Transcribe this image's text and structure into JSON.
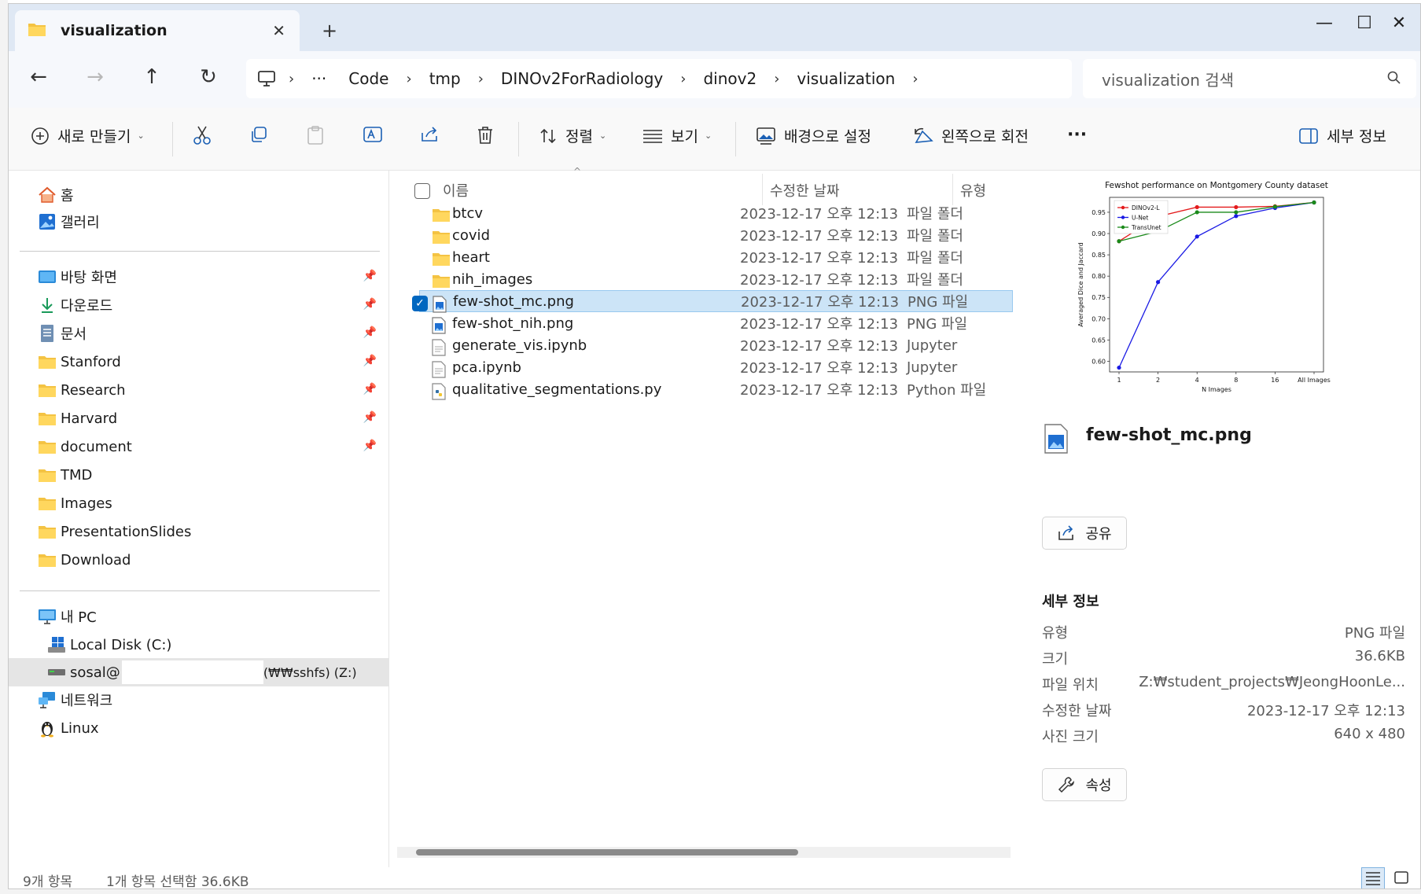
{
  "tab": {
    "title": "visualization",
    "close": "✕",
    "new_tab": "+"
  },
  "window_controls": {
    "minimize": "—",
    "maximize": "☐",
    "close": "✕"
  },
  "nav": {
    "back": "←",
    "forward": "→",
    "up": "↑",
    "refresh": "↻"
  },
  "address": {
    "ellipsis": "···",
    "segments": [
      "Code",
      "tmp",
      "DINOv2ForRadiology",
      "dinov2",
      "visualization"
    ]
  },
  "search": {
    "placeholder": "visualization 검색"
  },
  "commands": {
    "new": "새로 만들기",
    "sort": "정렬",
    "view": "보기",
    "set_background": "배경으로 설정",
    "rotate_left": "왼쪽으로 회전",
    "more": "···",
    "details": "세부 정보"
  },
  "sidebar": {
    "top": [
      {
        "label": "홈",
        "icon": "home-icon"
      },
      {
        "label": "갤러리",
        "icon": "gallery-icon"
      }
    ],
    "quick": [
      {
        "label": "바탕 화면",
        "icon": "desktop-icon",
        "pinned": true
      },
      {
        "label": "다운로드",
        "icon": "download-icon",
        "pinned": true
      },
      {
        "label": "문서",
        "icon": "documents-icon",
        "pinned": true
      },
      {
        "label": "Stanford",
        "icon": "folder-icon",
        "pinned": true
      },
      {
        "label": "Research",
        "icon": "folder-icon",
        "pinned": true
      },
      {
        "label": "Harvard",
        "icon": "folder-icon",
        "pinned": true
      },
      {
        "label": "document",
        "icon": "folder-icon",
        "pinned": true
      },
      {
        "label": "TMD",
        "icon": "folder-icon",
        "pinned": false
      },
      {
        "label": "Images",
        "icon": "folder-icon",
        "pinned": false
      },
      {
        "label": "PresentationSlides",
        "icon": "folder-icon",
        "pinned": false
      },
      {
        "label": "Download",
        "icon": "folder-icon",
        "pinned": false
      }
    ],
    "pc": {
      "label": "내 PC",
      "local_disk": "Local Disk (C:)",
      "network_drive_prefix": "sosal@",
      "network_drive_suffix": "(₩₩sshfs) (Z:)",
      "network": "네트워크",
      "linux": "Linux"
    }
  },
  "columns": {
    "name": "이름",
    "date": "수정한 날짜",
    "type": "유형"
  },
  "files": [
    {
      "name": "btcv",
      "date": "2023-12-17 오후 12:13",
      "type": "파일 폴더",
      "kind": "folder"
    },
    {
      "name": "covid",
      "date": "2023-12-17 오후 12:13",
      "type": "파일 폴더",
      "kind": "folder"
    },
    {
      "name": "heart",
      "date": "2023-12-17 오후 12:13",
      "type": "파일 폴더",
      "kind": "folder"
    },
    {
      "name": "nih_images",
      "date": "2023-12-17 오후 12:13",
      "type": "파일 폴더",
      "kind": "folder"
    },
    {
      "name": "few-shot_mc.png",
      "date": "2023-12-17 오후 12:13",
      "type": "PNG 파일",
      "kind": "image",
      "selected": true
    },
    {
      "name": "few-shot_nih.png",
      "date": "2023-12-17 오후 12:13",
      "type": "PNG 파일",
      "kind": "image"
    },
    {
      "name": "generate_vis.ipynb",
      "date": "2023-12-17 오후 12:13",
      "type": "Jupyter",
      "kind": "doc"
    },
    {
      "name": "pca.ipynb",
      "date": "2023-12-17 오후 12:13",
      "type": "Jupyter",
      "kind": "doc"
    },
    {
      "name": "qualitative_segmentations.py",
      "date": "2023-12-17 오후 12:13",
      "type": "Python 파일",
      "kind": "python"
    }
  ],
  "details": {
    "filename": "few-shot_mc.png",
    "share": "공유",
    "section": "세부 정보",
    "props": [
      {
        "k": "유형",
        "v": "PNG 파일"
      },
      {
        "k": "크기",
        "v": "36.6KB"
      },
      {
        "k": "파일 위치",
        "v": "Z:₩student_projects₩JeongHoonLe..."
      },
      {
        "k": "수정한 날짜",
        "v": "2023-12-17 오후 12:13"
      },
      {
        "k": "사진 크기",
        "v": "640 x 480"
      }
    ],
    "properties_button": "속성"
  },
  "status": {
    "count": "9개 항목",
    "selection": "1개 항목 선택함 36.6KB"
  },
  "chart_data": {
    "type": "line",
    "title": "Fewshot performance on Montgomery County dataset",
    "xlabel": "N Images",
    "ylabel": "Averaged Dice and Jaccard",
    "categories": [
      "1",
      "2",
      "4",
      "8",
      "16",
      "All Images"
    ],
    "yticks": [
      "0.60",
      "0.65",
      "0.70",
      "0.75",
      "0.80",
      "0.85",
      "0.90",
      "0.95"
    ],
    "ylim": [
      0.575,
      0.985
    ],
    "legend": "top-left",
    "series": [
      {
        "name": "DINOv2-L",
        "color": "#e41a1c",
        "values": [
          0.882,
          0.94,
          0.962,
          0.962,
          0.964,
          0.973
        ]
      },
      {
        "name": "U-Net",
        "color": "#1a1ae4",
        "values": [
          0.585,
          0.786,
          0.893,
          0.941,
          0.96,
          0.973
        ]
      },
      {
        "name": "TransUnet",
        "color": "#1a8a1a",
        "values": [
          0.882,
          0.905,
          0.95,
          0.95,
          0.963,
          0.973
        ]
      }
    ]
  }
}
